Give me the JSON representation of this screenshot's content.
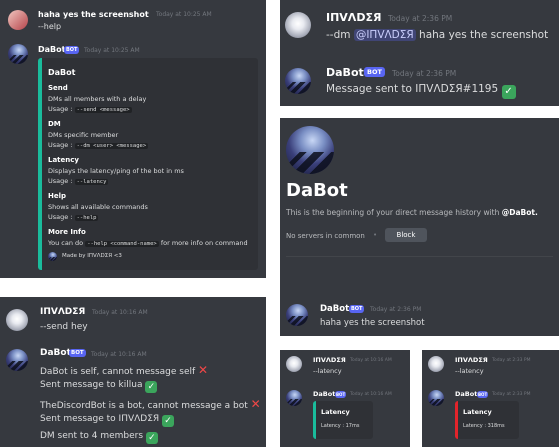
{
  "p1": {
    "user_name": "haha yes the screenshot",
    "user_time": "Today at 10:25 AM",
    "user_msg": "--help",
    "bot_name": "DaBot",
    "bot_tag": "BOT",
    "bot_time": "Today at 10:25 AM",
    "embed_title": "DaBot",
    "sections": [
      {
        "title": "Send",
        "desc": "DMs all members with a delay",
        "usage_prefix": "Usage :",
        "usage": "--send <message>"
      },
      {
        "title": "DM",
        "desc": "DMs specific member",
        "usage_prefix": "Usage :",
        "usage": "--dm <user> <message>"
      },
      {
        "title": "Latency",
        "desc": "Displays the latency/ping of the bot in ms",
        "usage_prefix": "Usage :",
        "usage": "--latency"
      },
      {
        "title": "Help",
        "desc": "Shows all available commands",
        "usage_prefix": "Usage :",
        "usage": "--help"
      }
    ],
    "more_title": "More Info",
    "more_pre": "You can do",
    "more_code": "--help <command-name>",
    "more_post": "for more info on command",
    "footer": "Made by IΠVΛDΣЯ <3"
  },
  "p2": {
    "user_name": "IΠVΛDΣЯ",
    "user_time": "Today at 2:36 PM",
    "cmd": "--dm",
    "mention": "@IΠVΛDΣЯ",
    "cmd_rest": "haha yes the screenshot",
    "bot_name": "DaBot",
    "bot_tag": "BOT",
    "bot_time": "Today at 2:36 PM",
    "bot_msg": "Message sent to IΠVΛDΣЯ#1195",
    "check": "✓"
  },
  "p3": {
    "title": "DaBot",
    "intro_pre": "This is the beginning of your direct message history with",
    "intro_name": "@DaBot.",
    "servers": "No servers in common",
    "block": "Block",
    "msg_name": "DaBot",
    "msg_tag": "BOT",
    "msg_time": "Today at 2:36 PM",
    "msg_text": "haha yes the screenshot"
  },
  "p4": {
    "user_name": "IΠVΛDΣЯ",
    "user_time": "Today at 10:16 AM",
    "user_msg": "--send hey",
    "bot_name": "DaBot",
    "bot_tag": "BOT",
    "bot_time": "Today at 10:16 AM",
    "lines": [
      "DaBot is self, cannot message self",
      "Sent message to killua",
      "TheDiscordBot is a bot, cannot message a bot",
      "Sent message to IΠVΛDΣЯ",
      "DM sent to 4 members"
    ],
    "cross": "✕",
    "check": "✓"
  },
  "p5": {
    "user_name": "IΠVΛDΣЯ",
    "user_time": "Today at 10:16 AM",
    "user_msg": "--latency",
    "bot_name": "DaBot",
    "bot_tag": "BOT",
    "bot_time": "Today at 10:16 AM",
    "embed_title": "Latency",
    "embed_text": "Latency : 17ms"
  },
  "p6": {
    "user_name": "IΠVΛDΣЯ",
    "user_time": "Today at 2:33 PM",
    "user_msg": "--latency",
    "bot_name": "DaBot",
    "bot_tag": "BOT",
    "bot_time": "Today at 2:33 PM",
    "embed_title": "Latency",
    "embed_text": "Latency : 318ms"
  },
  "colors": {
    "bg": "#36393f",
    "embed_bg": "#2f3136",
    "blurple": "#5865f2",
    "teal_bar": "#1abc9c",
    "red_bar": "#e3242b",
    "green": "#3ba55c",
    "red": "#f04747"
  }
}
